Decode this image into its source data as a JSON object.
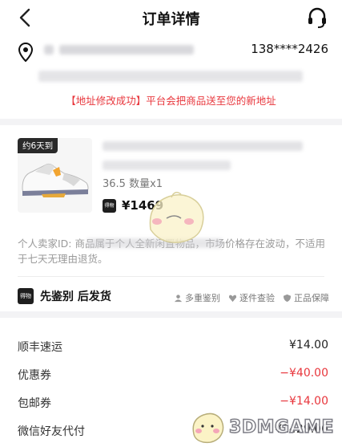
{
  "header": {
    "title": "订单详情",
    "back_icon": "chevron-left-icon",
    "support_icon": "headset-icon"
  },
  "address": {
    "phone": "138****2426",
    "success_note": "【地址修改成功】平台会把商品送至您的新地址",
    "pin_icon": "location-pin-icon"
  },
  "product": {
    "delivery_badge": "约6天到",
    "spec": "36.5 数量x1",
    "logo_text": "得物",
    "price": "¥1469"
  },
  "seller_note": "个人卖家ID:                              商品属于个人全新闲置物品，市场价格存在波动，不适用于七天无理由退货。",
  "verification": {
    "logo_text": "得物",
    "title": "先鉴别 后发货",
    "badges": [
      "多重鉴别",
      "逐件查验",
      "正品保障"
    ]
  },
  "fees": [
    {
      "label": "顺丰速运",
      "value": "¥14.00",
      "tone": "normal"
    },
    {
      "label": "优惠券",
      "value": "−¥40.00",
      "tone": "negative"
    },
    {
      "label": "包邮券",
      "value": "−¥14.00",
      "tone": "negative"
    },
    {
      "label": "微信好友代付",
      "value": "¥1429.00",
      "tone": "normal"
    }
  ],
  "watermark": {
    "text": "3DMGAME"
  },
  "colors": {
    "accent_red": "#e8363c",
    "text_dark": "#111111",
    "muted": "#9a9a9a",
    "background": "#f3f3f5"
  }
}
